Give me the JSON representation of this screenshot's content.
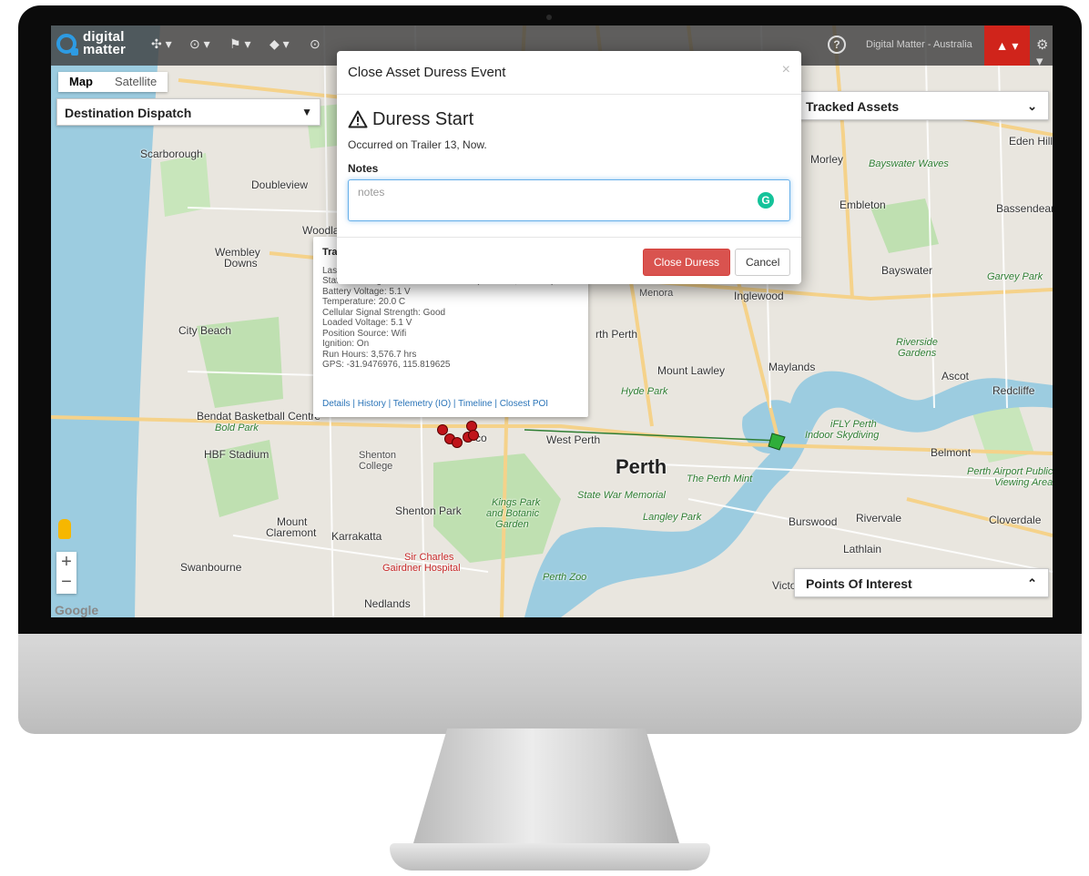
{
  "app": {
    "logo_line1": "digital",
    "logo_line2": "matter",
    "toolbar": [
      "✣ ▾",
      "⊙ ▾",
      "⚑ ▾",
      "◆ ▾",
      "⊙",
      "⚡ ▾",
      "✎ ▾",
      "▦ ▾",
      "⚲ ▾"
    ],
    "help": "?",
    "org_name": "Digital Matter - Australia",
    "alarm": "▲ ▾",
    "settings": "⚙ ▾"
  },
  "map": {
    "map_label": "Map",
    "satellite_label": "Satellite",
    "dispatch_label": "Destination Dispatch",
    "tracked_assets_label": "Tracked Assets",
    "poi_label": "Points Of Interest",
    "google": "Google",
    "zoom_in": "+",
    "zoom_out": "−",
    "places": {
      "scarborough": "Scarborough",
      "doubleview": "Doubleview",
      "wembley_downs": "Wembley",
      "downs": "Downs",
      "city_beach": "City Beach",
      "woodlands": "Woodla",
      "bendat": "Bendat Basketball Centre",
      "bold_park": "Bold Park",
      "hbf": "HBF Stadium",
      "shenton_college": "Shenton",
      "college": "College",
      "shenton_park": "Shenton Park",
      "mount_claremont": "Mount",
      "claremont": "Claremont",
      "karrakatta": "Karrakatta",
      "swanbourne": "Swanbourne",
      "sir_charles": "Sir Charles",
      "gairdner": "Gairdner Hospital",
      "nedlands": "Nedlands",
      "kings_park": "Kings Park",
      "and_botanic": "and Botanic",
      "garden": "Garden",
      "perth_zoo": "Perth Zoo",
      "west_perth": "West Perth",
      "perth": "Perth",
      "perth_mint": "The Perth Mint",
      "state_war": "State War Memorial",
      "langley": "Langley Park",
      "north_perth": "rth Perth",
      "hyde_park": "Hyde Park",
      "mount_lawley": "Mount Lawley",
      "maylands": "Maylands",
      "menora": "Menora",
      "inglewood": "Inglewood",
      "bayswater": "Bayswater",
      "bayswater_waves": "Bayswater Waves",
      "morley": "Morley",
      "embleton": "Embleton",
      "bassendean": "Bassendean",
      "eden_hill": "Eden Hill",
      "garvey_park": "Garvey Park",
      "riverside": "Riverside",
      "gardens": "Gardens",
      "ascot": "Ascot",
      "redcliffe": "Redcliffe",
      "ifly": "iFLY Perth",
      "indoor_sky": "Indoor Skydiving",
      "belmont": "Belmont",
      "airport": "Perth Airport Public",
      "viewing": "Viewing Area",
      "burswood": "Burswood",
      "rivervale": "Rivervale",
      "cloverdale": "Cloverdale",
      "lathlain": "Lathlain",
      "victoria": "Victoria",
      "subiaco": "co"
    }
  },
  "info_popup": {
    "title": "Tra",
    "line0": "Las",
    "status": "Status: Driving from DMA since 12:39 (for 1 min, 21 secs)",
    "battery": "Battery Voltage: 5.1 V",
    "temperature": "Temperature: 20.0 C",
    "signal": "Cellular Signal Strength: Good",
    "loaded": "Loaded Voltage: 5.1 V",
    "position": "Position Source: Wifi",
    "ignition": "Ignition: On",
    "run_hours": "Run Hours: 3,576.7 hrs",
    "gps": "GPS: -31.9476976, 115.819625",
    "links": "Details | History | Telemetry (IO) | Timeline | Closest POI"
  },
  "modal": {
    "title": "Close Asset Duress Event",
    "close_x": "×",
    "heading": "Duress Start",
    "occurred": "Occurred on Trailer 13, Now.",
    "notes_label": "Notes",
    "notes_placeholder": "notes",
    "notes_value": "",
    "grammarly": "G",
    "close_duress_label": "Close Duress",
    "cancel_label": "Cancel"
  },
  "colors": {
    "danger": "#d9534f",
    "alarm": "#d0241b",
    "brand_blue": "#2d9be3",
    "focus": "#66afe9"
  }
}
